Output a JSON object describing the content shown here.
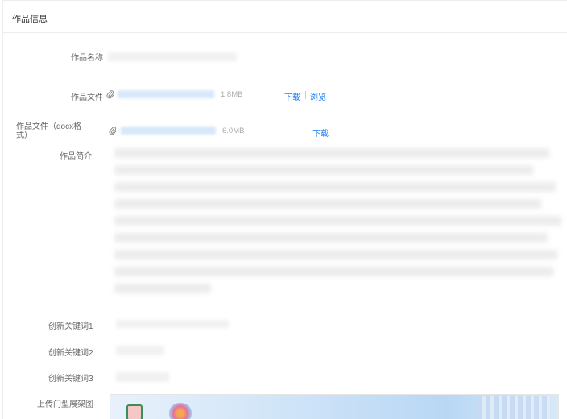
{
  "panel": {
    "title": "作品信息"
  },
  "fields": {
    "name_label": "作品名称",
    "file_label": "作品文件",
    "file_size": "1.8MB",
    "file_download": "下载",
    "file_preview": "浏览",
    "docx_label_line1": "作品文件（docx格",
    "docx_label_line2": "式）",
    "docx_size": "6.0MB",
    "docx_download": "下载",
    "intro_label": "作品简介",
    "keyword1_label": "创新关键词1",
    "keyword2_label": "创新关键词2",
    "keyword3_label": "创新关键词3",
    "image_label": "上传门型展架图"
  },
  "icons": {
    "attachment": "paperclip-icon"
  },
  "colors": {
    "link": "#1e7ff0",
    "file_name": "#d7e8fb"
  }
}
